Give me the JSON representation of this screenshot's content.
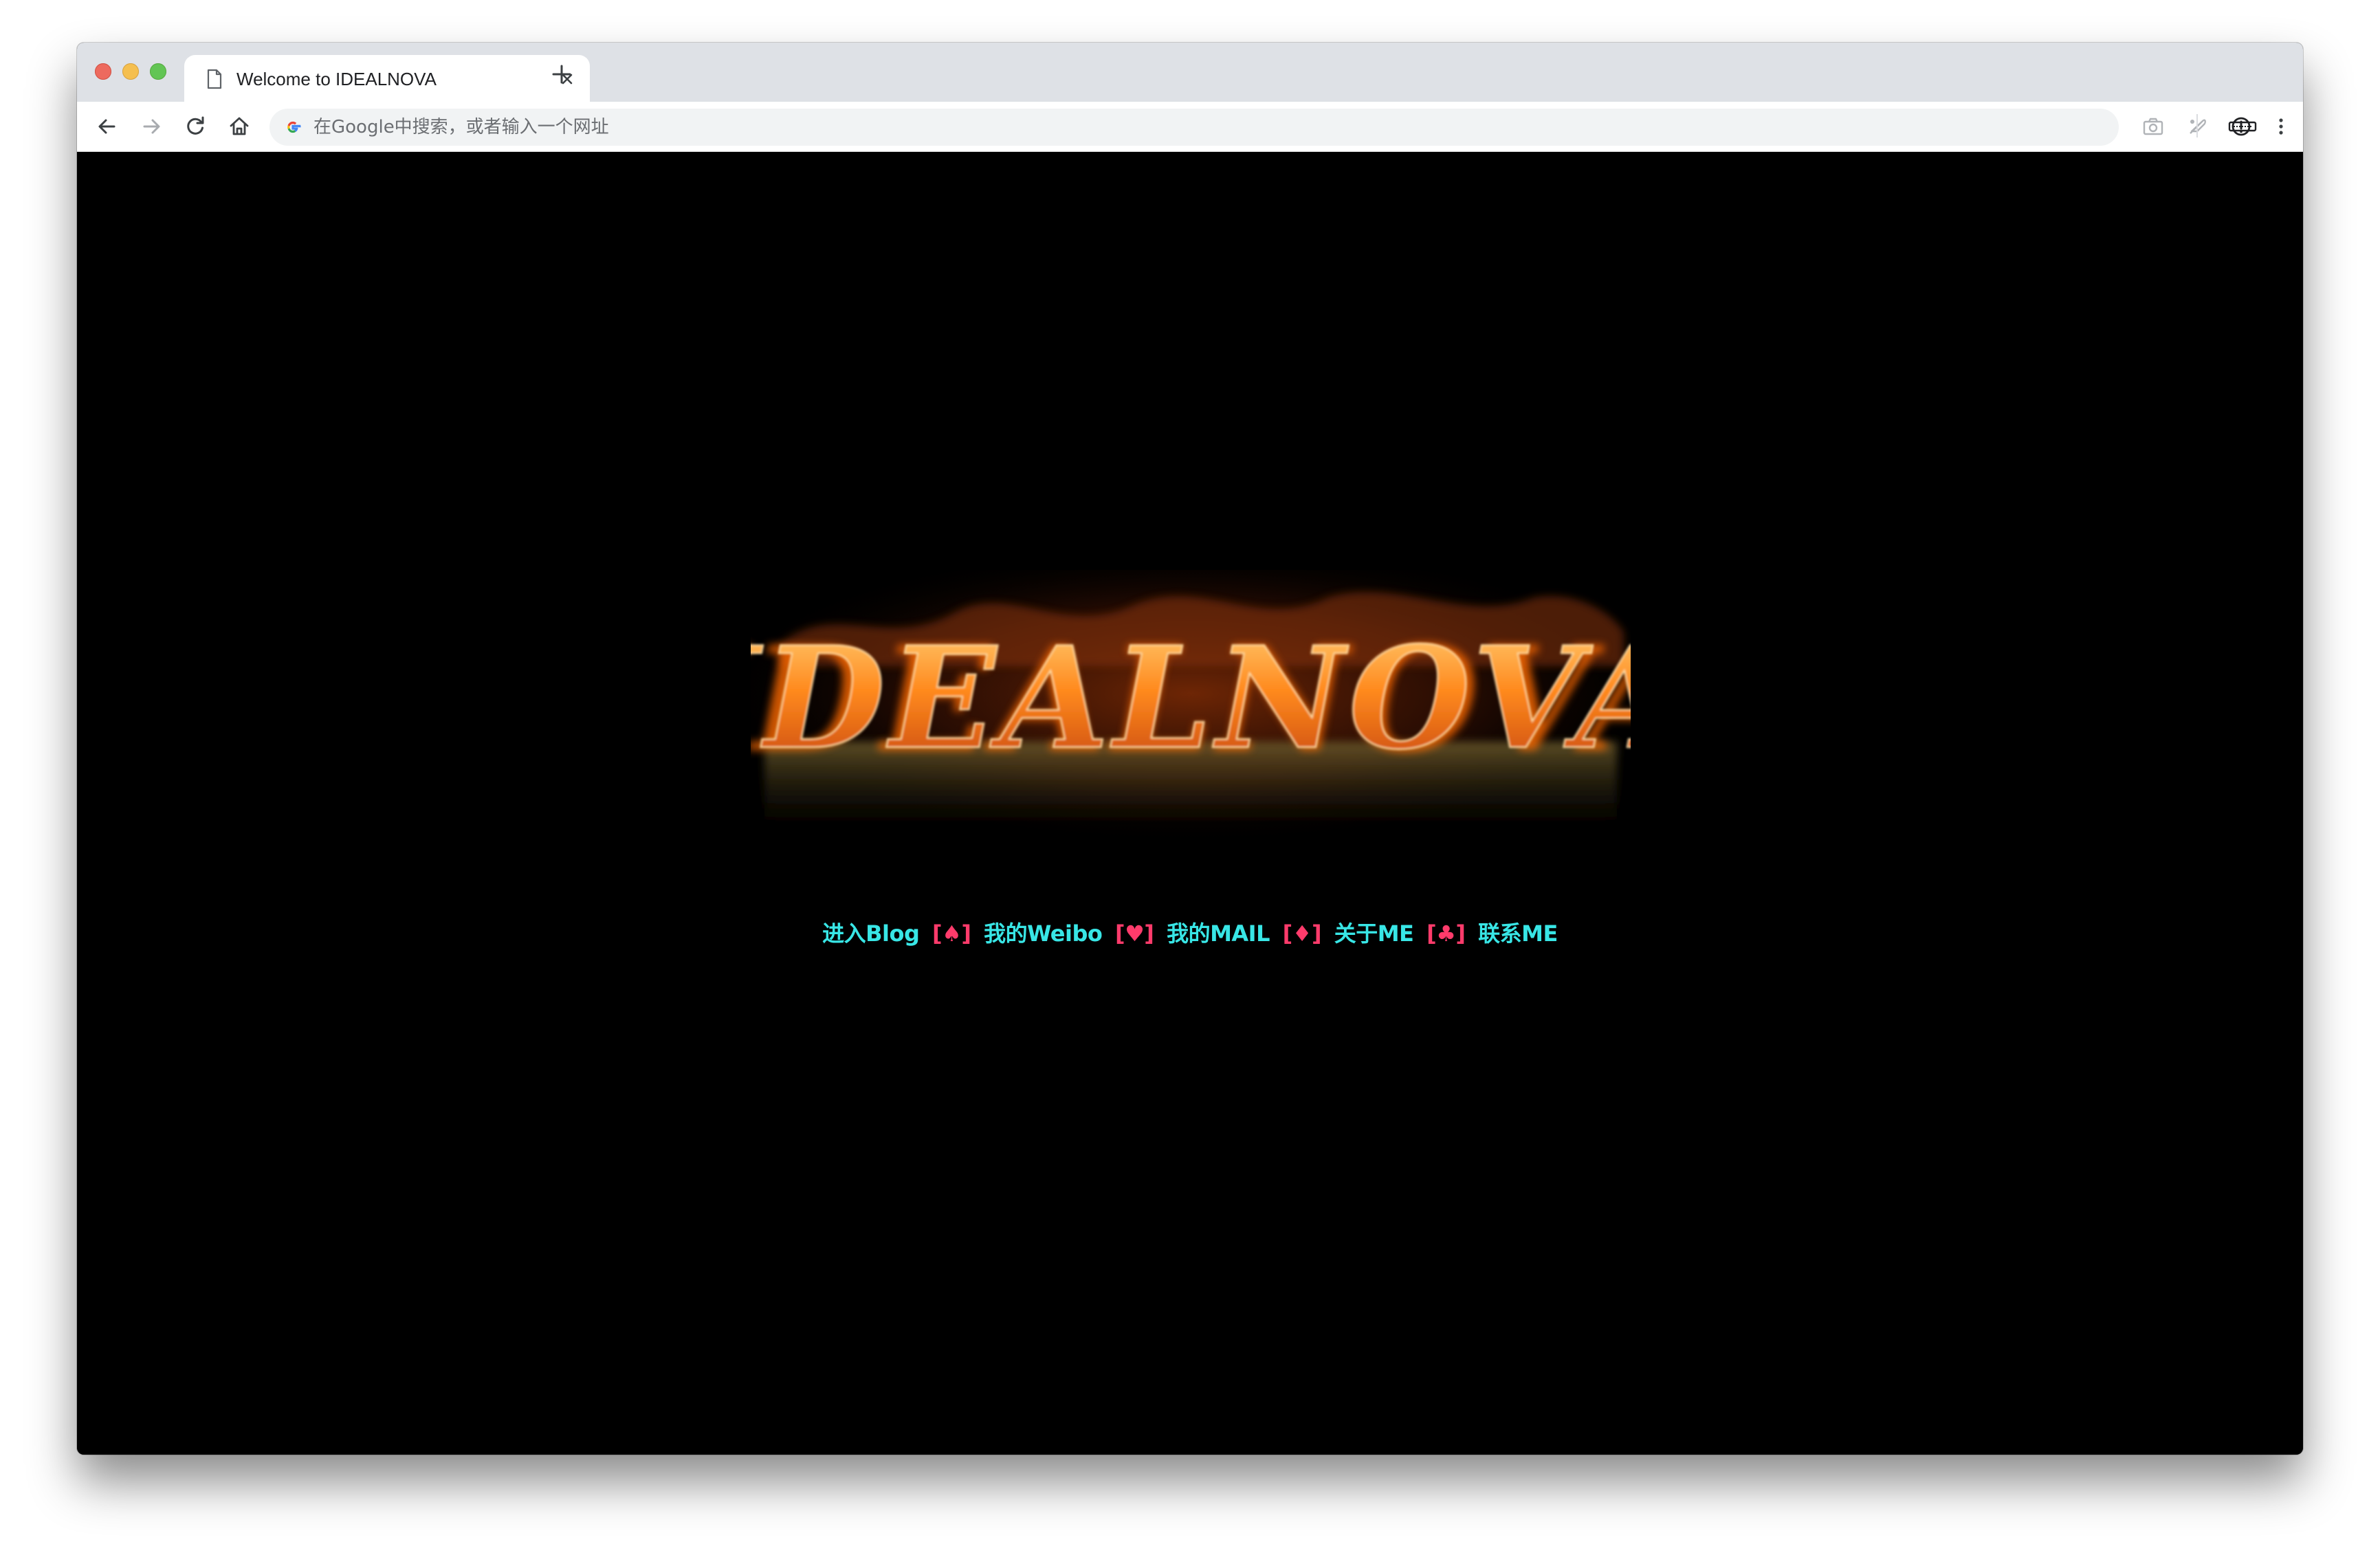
{
  "browser": {
    "tab": {
      "title": "Welcome to IDEALNOVA",
      "icon": "document-icon"
    },
    "toolbar": {
      "back_icon": "back-arrow-icon",
      "forward_icon": "forward-arrow-icon",
      "reload_icon": "reload-icon",
      "home_icon": "home-icon"
    },
    "omnibox": {
      "placeholder": "在Google中搜索，或者输入一个网址",
      "value": ""
    },
    "extensions": [
      "camera-icon",
      "feather-icon",
      "info-icon",
      "keyboard-icon",
      "more-menu-icon"
    ]
  },
  "page": {
    "logo_text": "IDEALNOVA",
    "nav": {
      "blog": "进入Blog",
      "sep1": "[♠]",
      "weibo": "我的Weibo",
      "sep2": "[♥]",
      "mail": "我的MAIL",
      "sep3": "[♦]",
      "about": "关于ME",
      "sep4": "[♣]",
      "contact": "联系ME"
    },
    "colors": {
      "background": "#000000",
      "link": "#38e6e6",
      "separator": "#ff3b6b",
      "fire": "#ff8a1e"
    }
  }
}
